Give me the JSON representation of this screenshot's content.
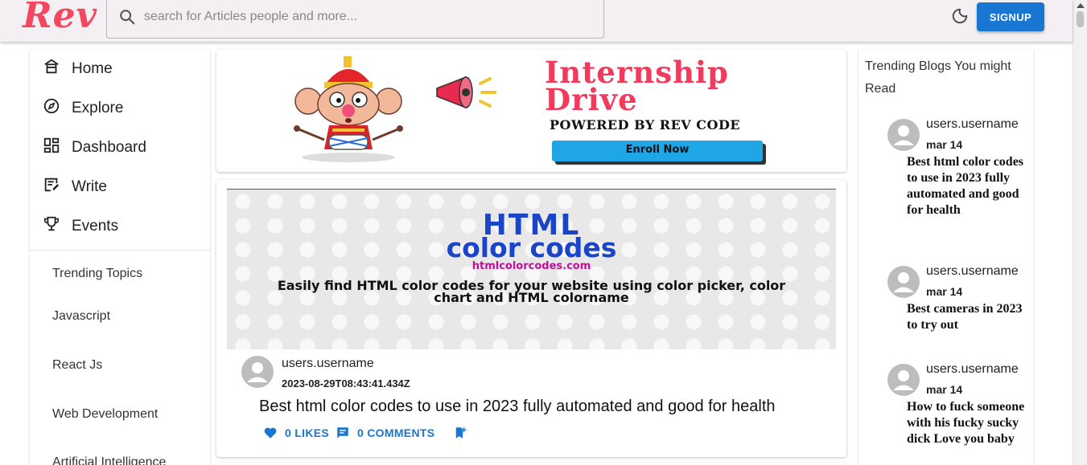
{
  "header": {
    "logo": "Rev",
    "search_placeholder": "search for Articles people and more...",
    "signup_label": "SIGNUP"
  },
  "sidebar": {
    "nav": [
      {
        "label": "Home",
        "icon": "home-icon"
      },
      {
        "label": "Explore",
        "icon": "compass-icon"
      },
      {
        "label": "Dashboard",
        "icon": "dashboard-icon"
      },
      {
        "label": "Write",
        "icon": "edit-note-icon"
      },
      {
        "label": "Events",
        "icon": "trophy-icon"
      }
    ],
    "topics": [
      "Trending Topics",
      "Javascript",
      "React Js",
      "Web Development",
      "Artificial Intelligence"
    ]
  },
  "banner": {
    "title_line1": "Internship",
    "title_line2": "Drive",
    "powered": "POWERED BY REV CODE",
    "cta": "Enroll Now"
  },
  "post": {
    "image_title1": "HTML",
    "image_title2": "color codes",
    "image_site": "htmlcolorcodes.com",
    "image_desc": "Easily find HTML color codes for your website using color picker, color chart and HTML colorname",
    "username": "users.username",
    "date": "2023-08-29T08:43:41.434Z",
    "title": "Best html color codes to use in 2023 fully automated and good for health",
    "likes": "0 LIKES",
    "comments": "0 COMMENTS"
  },
  "trending": {
    "heading": "Trending Blogs You might Read",
    "items": [
      {
        "username": "users.username",
        "date": "mar 14",
        "title": "Best html color codes to use in 2023 fully automated and good for health"
      },
      {
        "username": "users.username",
        "date": "mar 14",
        "title": "Best cameras in 2023 to try out"
      },
      {
        "username": "users.username",
        "date": "mar 14",
        "title": "How to fuck someone with his fucky sucky dick Love you baby"
      }
    ]
  },
  "colors": {
    "brand": "#f2475f",
    "primary": "#1976d2",
    "appbar": "#f4eff2"
  }
}
